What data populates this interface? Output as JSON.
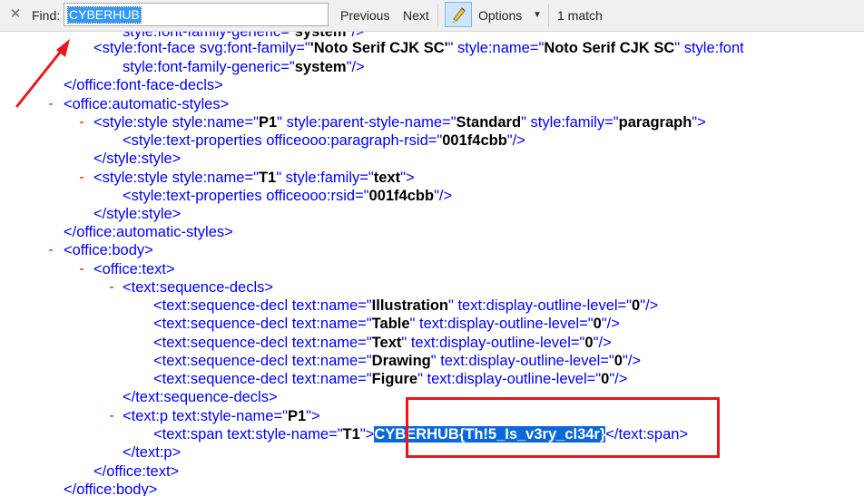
{
  "findbar": {
    "close_icon": "✕",
    "find_label": "Find:",
    "search_value": "CYBERHUB",
    "previous_label": "Previous",
    "next_label": "Next",
    "options_label": "Options",
    "match_count": "1 match"
  },
  "xml": {
    "l0": {
      "t1": "style:font-family-generic=\"",
      "v1": "system",
      "t2": "\"/>"
    },
    "l1": {
      "t1": "<style:font-face svg:font-family=\"",
      "v1": "'Noto Serif CJK SC'",
      "t2": "\" style:name=\"",
      "v2": "Noto Serif CJK SC",
      "t3": "\" style:font"
    },
    "l2": {
      "t1": "style:font-family-generic=\"",
      "v1": "system",
      "t2": "\"/>"
    },
    "l3": {
      "t1": "</office:font-face-decls>"
    },
    "l4": {
      "t1": "<office:automatic-styles>"
    },
    "l5": {
      "t1": "<style:style style:name=\"",
      "v1": "P1",
      "t2": "\" style:parent-style-name=\"",
      "v2": "Standard",
      "t3": "\" style:family=\"",
      "v3": "paragraph",
      "t4": "\">"
    },
    "l6": {
      "t1": "<style:text-properties officeooo:paragraph-rsid=\"",
      "v1": "001f4cbb",
      "t2": "\"/>"
    },
    "l7": {
      "t1": "</style:style>"
    },
    "l8": {
      "t1": "<style:style style:name=\"",
      "v1": "T1",
      "t2": "\" style:family=\"",
      "v2": "text",
      "t3": "\">"
    },
    "l9": {
      "t1": "<style:text-properties officeooo:rsid=\"",
      "v1": "001f4cbb",
      "t2": "\"/>"
    },
    "l10": {
      "t1": "</style:style>"
    },
    "l11": {
      "t1": "</office:automatic-styles>"
    },
    "l12": {
      "t1": "<office:body>"
    },
    "l13": {
      "t1": "<office:text>"
    },
    "l14": {
      "t1": "<text:sequence-decls>"
    },
    "l15": {
      "t1": "<text:sequence-decl text:name=\"",
      "v1": "Illustration",
      "t2": "\" text:display-outline-level=\"",
      "v2": "0",
      "t3": "\"/>"
    },
    "l16": {
      "t1": "<text:sequence-decl text:name=\"",
      "v1": "Table",
      "t2": "\" text:display-outline-level=\"",
      "v2": "0",
      "t3": "\"/>"
    },
    "l17": {
      "t1": "<text:sequence-decl text:name=\"",
      "v1": "Text",
      "t2": "\" text:display-outline-level=\"",
      "v2": "0",
      "t3": "\"/>"
    },
    "l18": {
      "t1": "<text:sequence-decl text:name=\"",
      "v1": "Drawing",
      "t2": "\" text:display-outline-level=\"",
      "v2": "0",
      "t3": "\"/>"
    },
    "l19": {
      "t1": "<text:sequence-decl text:name=\"",
      "v1": "Figure",
      "t2": "\" text:display-outline-level=\"",
      "v2": "0",
      "t3": "\"/>"
    },
    "l20": {
      "t1": "</text:sequence-decls>"
    },
    "l21": {
      "t1": "<text:p text:style-name=\"",
      "v1": "P1",
      "t2": "\">"
    },
    "l22": {
      "t1": "<text:span text:style-name=\"",
      "v1": "T1",
      "t2": "\">",
      "h1": "CYBERHUB{Th!5_Is_v3ry_cl34r}",
      "t3": "</text:span>"
    },
    "l23": {
      "t1": "</text:p>"
    },
    "l24": {
      "t1": "</office:text>"
    },
    "l25": {
      "t1": "</office:body>"
    }
  },
  "colors": {
    "tag": "#0000ff",
    "value": "#000000",
    "collapse": "#ff0000",
    "annotation": "#e8171e",
    "selection": "#0a68d8"
  }
}
